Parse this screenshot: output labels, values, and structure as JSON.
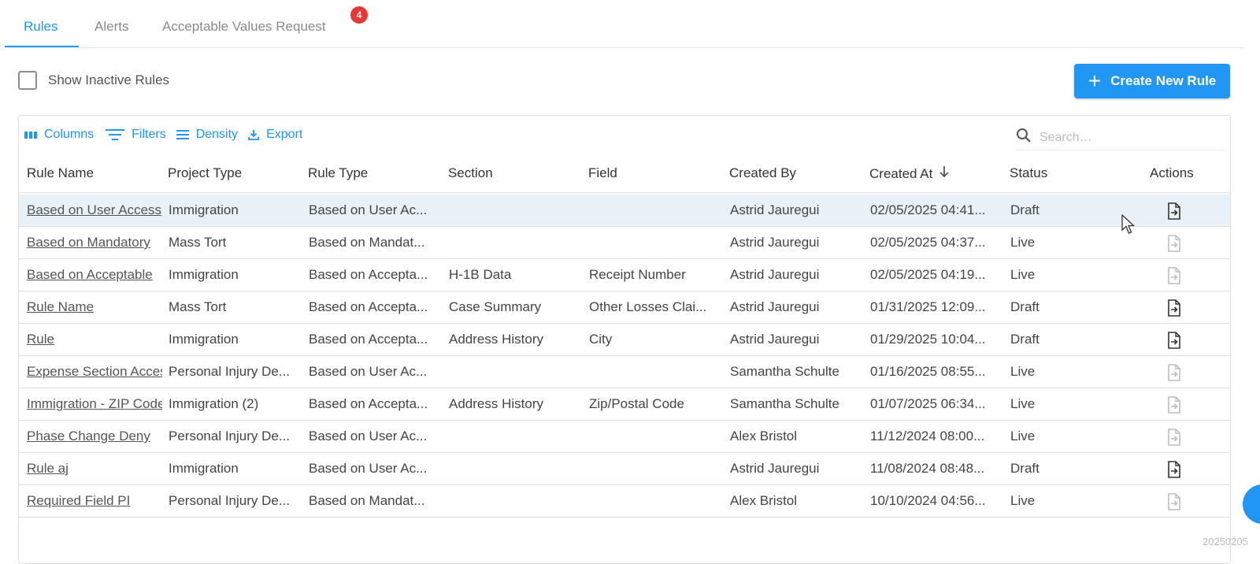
{
  "tabs": [
    {
      "label": "Rules",
      "active": true
    },
    {
      "label": "Alerts",
      "active": false
    },
    {
      "label": "Acceptable Values Request",
      "active": false,
      "badge": "4"
    }
  ],
  "show_inactive": {
    "label": "Show Inactive Rules",
    "checked": false
  },
  "create_button": {
    "label": "Create New Rule"
  },
  "toolbar": {
    "columns": "Columns",
    "filters": "Filters",
    "density": "Density",
    "export": "Export"
  },
  "search": {
    "placeholder": "Search…",
    "value": ""
  },
  "columns": {
    "rule_name": "Rule Name",
    "project_type": "Project Type",
    "rule_type": "Rule Type",
    "section": "Section",
    "field": "Field",
    "created_by": "Created By",
    "created_at": "Created At",
    "status": "Status",
    "actions": "Actions"
  },
  "sort": {
    "column": "created_at",
    "direction": "desc"
  },
  "rows": [
    {
      "name": "Based on User Access",
      "project_type": "Immigration",
      "rule_type": "Based on User Ac...",
      "section": "",
      "field": "",
      "created_by": "Astrid Jauregui",
      "created_at": "02/05/2025 04:41...",
      "status": "Draft",
      "selected": true
    },
    {
      "name": "Based on Mandatory",
      "project_type": "Mass Tort",
      "rule_type": "Based on Mandat...",
      "section": "",
      "field": "",
      "created_by": "Astrid Jauregui",
      "created_at": "02/05/2025 04:37...",
      "status": "Live",
      "selected": false
    },
    {
      "name": "Based on Acceptable",
      "project_type": "Immigration",
      "rule_type": "Based on Accepta...",
      "section": "H-1B Data",
      "field": "Receipt Number",
      "created_by": "Astrid Jauregui",
      "created_at": "02/05/2025 04:19...",
      "status": "Live",
      "selected": false
    },
    {
      "name": "Rule Name",
      "project_type": "Mass Tort",
      "rule_type": "Based on Accepta...",
      "section": "Case Summary",
      "field": "Other Losses Clai...",
      "created_by": "Astrid Jauregui",
      "created_at": "01/31/2025 12:09...",
      "status": "Draft",
      "selected": false
    },
    {
      "name": "Rule",
      "project_type": "Immigration",
      "rule_type": "Based on Accepta...",
      "section": "Address History",
      "field": "City",
      "created_by": "Astrid Jauregui",
      "created_at": "01/29/2025 10:04...",
      "status": "Draft",
      "selected": false
    },
    {
      "name": "Expense Section Access",
      "project_type": "Personal Injury De...",
      "rule_type": "Based on User Ac...",
      "section": "",
      "field": "",
      "created_by": "Samantha Schulte",
      "created_at": "01/16/2025 08:55...",
      "status": "Live",
      "selected": false
    },
    {
      "name": "Immigration - ZIP Code",
      "project_type": "Immigration (2)",
      "rule_type": "Based on Accepta...",
      "section": "Address History",
      "field": "Zip/Postal Code",
      "created_by": "Samantha Schulte",
      "created_at": "01/07/2025 06:34...",
      "status": "Live",
      "selected": false
    },
    {
      "name": "Phase Change Deny",
      "project_type": "Personal Injury De...",
      "rule_type": "Based on User Ac...",
      "section": "",
      "field": "",
      "created_by": "Alex Bristol",
      "created_at": "11/12/2024 08:00...",
      "status": "Live",
      "selected": false
    },
    {
      "name": "Rule aj",
      "project_type": "Immigration",
      "rule_type": "Based on User Ac...",
      "section": "",
      "field": "",
      "created_by": "Astrid Jauregui",
      "created_at": "11/08/2024 08:48...",
      "status": "Draft",
      "selected": false
    },
    {
      "name": "Required Field PI",
      "project_type": "Personal Injury De...",
      "rule_type": "Based on Mandat...",
      "section": "",
      "field": "",
      "created_by": "Alex Bristol",
      "created_at": "10/10/2024 04:56...",
      "status": "Live",
      "selected": false
    }
  ],
  "watermark": "20250205",
  "colors": {
    "accent": "#2196f3",
    "badge": "#e53935",
    "selected_row": "#e8f1f8",
    "active_action_icon": "#333333",
    "inactive_action_icon": "#bdbdbd"
  },
  "icons": {
    "columns": "columns-icon",
    "filters": "filter-icon",
    "density": "density-icon",
    "export": "export-icon",
    "search": "search-icon",
    "action": "file-arrow-icon",
    "create": "plus-icon"
  }
}
